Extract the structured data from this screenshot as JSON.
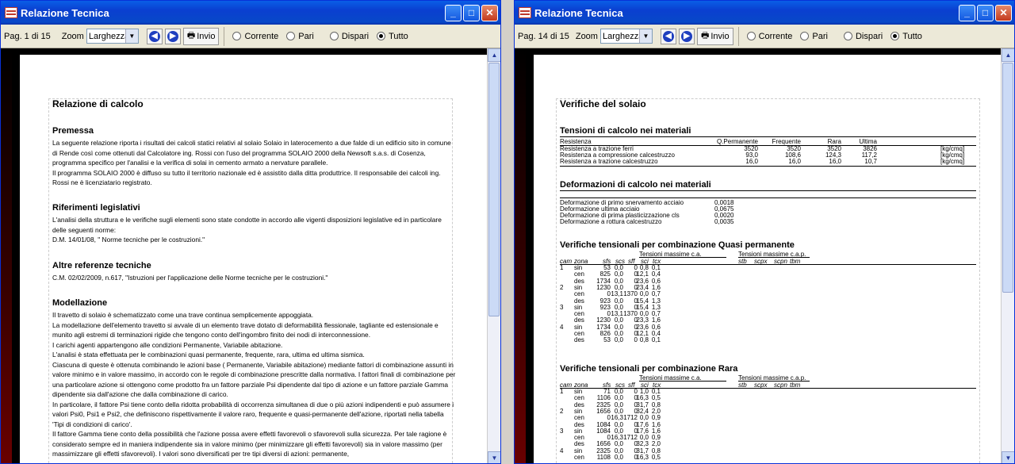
{
  "left_window": {
    "title": "Relazione Tecnica",
    "page_label": "Pag. 1 di 15",
    "zoom_label": "Zoom",
    "zoom_value": "Larghezza",
    "send_label": "Invio",
    "radios": [
      "Corrente",
      "Pari",
      "Dispari",
      "Tutto"
    ],
    "selected_radio": "Tutto",
    "doc": {
      "title": "Relazione di calcolo",
      "sections": [
        {
          "heading": "Premessa",
          "text": "La seguente relazione riporta i risultati dei calcoli statici relativi al solaio Solaio in laterocemento a due falde di un edificio sito in comune di Rende così come ottenuti dal Calcolatore ing. Rossi con l'uso del programma SOLAIO 2000 della Newsoft s.a.s. di Cosenza, programma specifico per l'analisi e la verifica di solai in cemento armato a nervature parallele.\nIl programma SOLAIO 2000 è diffuso su tutto il territorio nazionale ed è assistito dalla ditta produttrice. Il responsabile dei calcoli ing. Rossi ne è licenziatario registrato."
        },
        {
          "heading": "Riferimenti legislativi",
          "text": "L'analisi della struttura e le verifiche sugli elementi sono state condotte in accordo alle vigenti disposizioni legislative ed in particolare delle seguenti norme:\nD.M. 14/01/08, \" Norme tecniche per le costruzioni.\""
        },
        {
          "heading": "Altre referenze tecniche",
          "text": "C.M. 02/02/2009, n.617, \"Istruzioni per l'applicazione delle Norme tecniche per le costruzioni.\""
        },
        {
          "heading": "Modellazione",
          "text": "Il travetto di solaio è schematizzato come una trave continua semplicemente appoggiata.\nLa modellazione dell'elemento travetto si avvale di un elemento trave dotato di deformabilità flessionale, tagliante ed estensionale e munito agli estremi di terminazioni rigide che tengono conto dell'ingombro finito dei nodi di interconnessione.\nI carichi agenti appartengono alle condizioni Permanente, Variabile abitazione.\nL'analisi è stata effettuata per le combinazioni quasi permanente, frequente, rara, ultima ed ultima sismica.\nCiascuna di queste è ottenuta combinando le azioni base ( Permanente, Variabile abitazione) mediante fattori di combinazione assunti in valore minimo e in valore massimo, in accordo con le regole di combinazione prescritte dalla normativa. I fattori finali di combinazione per una particolare azione si ottengono come prodotto fra un fattore parziale Psi dipendente dal tipo di azione e un fattore parziale Gamma dipendente sia dall'azione che dalla combinazione di carico.\nIn particolare, il fattore Psi tiene conto della ridotta probabilità di occorrenza simultanea di due o più azioni indipendenti e può assumere i valori Psi0, Psi1 e Psi2, che definiscono rispettivamente il valore raro, frequente e quasi-permanente dell'azione, riportati nella tabella 'Tipi di condizioni di carico'.\nIl fattore Gamma tiene conto della possibilità che l'azione possa avere effetti favorevoli o sfavorevoli sulla sicurezza. Per tale ragione è considerato sempre ed in maniera indipendente sia in valore minimo (per minimizzare gli effetti favorevoli) sia in valore massimo (per massimizzare gli effetti sfavorevoli). I valori sono diversificati per tre tipi diversi di azioni: permanente,"
        }
      ]
    }
  },
  "right_window": {
    "title": "Relazione Tecnica",
    "page_label": "Pag. 14 di 15",
    "zoom_label": "Zoom",
    "zoom_value": "Larghezza",
    "send_label": "Invio",
    "radios": [
      "Corrente",
      "Pari",
      "Dispari",
      "Tutto"
    ],
    "selected_radio": "Tutto",
    "doc": {
      "title": "Verifiche del solaio",
      "tensioni_heading": "Tensioni di calcolo nei materiali",
      "tensioni_header": [
        "Resistenza",
        "Q.Permanente",
        "Frequente",
        "Rara",
        "Ultima"
      ],
      "tensioni_rows": [
        [
          "Resistenza a trazione ferri",
          "3520",
          "3520",
          "3520",
          "3826",
          "[kg/cmq]"
        ],
        [
          "Resistenza a compressione calcestruzzo",
          "93,0",
          "108,6",
          "124,3",
          "117,2",
          "[kg/cmq]"
        ],
        [
          "Resistenza a trazione calcestruzzo",
          "16,0",
          "16,0",
          "16,0",
          "10,7",
          "[kg/cmq]"
        ]
      ],
      "deform_heading": "Deformazioni di calcolo nei materiali",
      "deform_rows": [
        [
          "Deformazione di primo snervamento acciaio",
          "0,0018"
        ],
        [
          "Deformazione ultima acciaio",
          "0,0675"
        ],
        [
          "Deformazione di prima plasticizzazione cls",
          "0,0020"
        ],
        [
          "Deformazione a rottura calcestruzzo",
          "0,0035"
        ]
      ],
      "qp_heading": "Verifiche tensionali per combinazione Quasi permanente",
      "group_ca": "Tensioni massime c.a.",
      "group_cap": "Tensioni massime c.a.p.",
      "cols": [
        "cam",
        "zona",
        "sfs",
        "scs",
        "sff",
        "sci",
        "tcx",
        "stb",
        "scpx",
        "scpn",
        "tbm"
      ],
      "qp_rows": [
        [
          "1",
          "sin",
          "53",
          "0,0",
          "0",
          "0,8",
          "0,1"
        ],
        [
          "",
          "cen",
          "825",
          "0,0",
          "0",
          "12,1",
          "0,4"
        ],
        [
          "",
          "des",
          "1734",
          "0,0",
          "0",
          "23,6",
          "0,6"
        ],
        [
          "2",
          "sin",
          "1230",
          "0,0",
          "0",
          "23,4",
          "1,6"
        ],
        [
          "",
          "cen",
          "0",
          "13,1",
          "1370",
          "0,0",
          "0,7"
        ],
        [
          "",
          "des",
          "923",
          "0,0",
          "0",
          "15,4",
          "1,3"
        ],
        [
          "3",
          "sin",
          "923",
          "0,0",
          "0",
          "15,4",
          "1,3"
        ],
        [
          "",
          "cen",
          "0",
          "13,1",
          "1370",
          "0,0",
          "0,7"
        ],
        [
          "",
          "des",
          "1230",
          "0,0",
          "0",
          "23,3",
          "1,6"
        ],
        [
          "4",
          "sin",
          "1734",
          "0,0",
          "0",
          "23,6",
          "0,6"
        ],
        [
          "",
          "cen",
          "826",
          "0,0",
          "0",
          "12,1",
          "0,4"
        ],
        [
          "",
          "des",
          "53",
          "0,0",
          "0",
          "0,8",
          "0,1"
        ]
      ],
      "rara_heading": "Verifiche tensionali per combinazione Rara",
      "rara_rows": [
        [
          "1",
          "sin",
          "71",
          "0,0",
          "0",
          "1,0",
          "0,1"
        ],
        [
          "",
          "cen",
          "1106",
          "0,0",
          "0",
          "16,3",
          "0,5"
        ],
        [
          "",
          "des",
          "2325",
          "0,0",
          "0",
          "31,7",
          "0,8"
        ],
        [
          "2",
          "sin",
          "1656",
          "0,0",
          "0",
          "32,4",
          "2,0"
        ],
        [
          "",
          "cen",
          "0",
          "16,3",
          "1712",
          "0,0",
          "0,9"
        ],
        [
          "",
          "des",
          "1084",
          "0,0",
          "0",
          "17,6",
          "1,6"
        ],
        [
          "3",
          "sin",
          "1084",
          "0,0",
          "0",
          "17,6",
          "1,6"
        ],
        [
          "",
          "cen",
          "0",
          "16,3",
          "1712",
          "0,0",
          "0,9"
        ],
        [
          "",
          "des",
          "1656",
          "0,0",
          "0",
          "32,3",
          "2,0"
        ],
        [
          "4",
          "sin",
          "2325",
          "0,0",
          "0",
          "31,7",
          "0,8"
        ],
        [
          "",
          "cen",
          "1108",
          "0,0",
          "0",
          "16,3",
          "0,5"
        ]
      ]
    }
  }
}
